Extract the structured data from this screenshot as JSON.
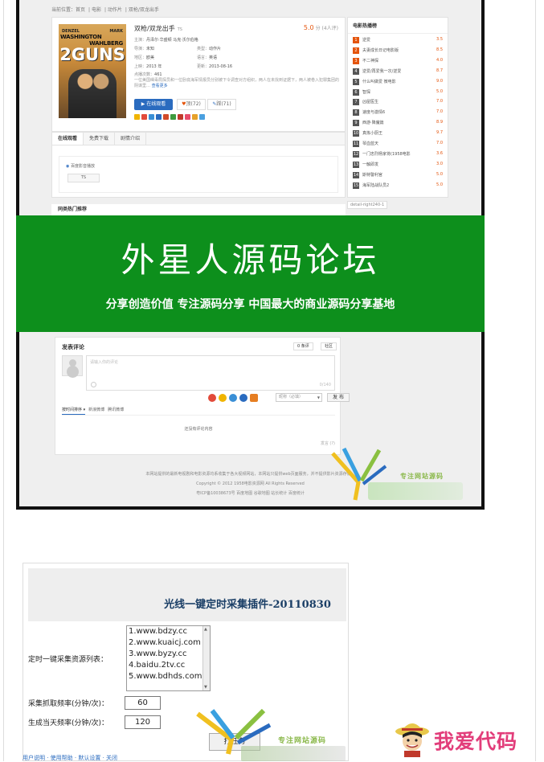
{
  "breadcrumb": [
    "当前位置：首页",
    "电影",
    "动作片",
    "双枪/双龙出手"
  ],
  "movie": {
    "title": "双枪/双龙出手",
    "tag": "TS",
    "score": "5.0",
    "score_unit": "分",
    "votes": "(4人评)",
    "info": [
      {
        "label": "主演：",
        "value": "丹泽尔·华盛顿  马克·沃尔伯格"
      },
      {
        "label": "导演：",
        "value": "未知"
      },
      {
        "label": "类型：",
        "value": "动作片"
      },
      {
        "label": "地区：",
        "value": "欧美"
      },
      {
        "label": "语言：",
        "value": "英语"
      },
      {
        "label": "上映：",
        "value": "2013 年"
      },
      {
        "label": "更新：",
        "value": "2013-08-16"
      },
      {
        "label": "点播次数：",
        "value": "461"
      }
    ],
    "description": "一位美国缉毒局探员和一位卧底海军情报员分别被下令调查对方组织，两人在未找到证据下，两人被卷入犯罪集团的阴谋里…",
    "more": "查看更多",
    "watch_btn": "在线观看",
    "up_btn": "顶(72)",
    "down_btn": "踩(71)",
    "poster": {
      "actor1": "DENZEL",
      "actor2": "MARK",
      "line1": "WASHINGTON",
      "line2": "WAHLBERG",
      "big": "2GUNS"
    }
  },
  "tabs": [
    "在线观看",
    "免费下载",
    "剧情介绍"
  ],
  "player": {
    "label": "百度影音播放",
    "ts": "TS"
  },
  "sidebar": {
    "title": "电影热播榜",
    "items": [
      {
        "no": "1",
        "name": "逆爱",
        "score": "3.5"
      },
      {
        "no": "2",
        "name": "夫妻成长日记电影版",
        "score": "8.5"
      },
      {
        "no": "3",
        "name": "不二神探",
        "score": "4.0"
      },
      {
        "no": "4",
        "name": "逆爱/再爱我一次/逆爱",
        "score": "8.7"
      },
      {
        "no": "5",
        "name": "什么叫做爱 微电影",
        "score": "9.0"
      },
      {
        "no": "6",
        "name": "智探",
        "score": "5.0"
      },
      {
        "no": "7",
        "name": "凶屋医生",
        "score": "7.0"
      },
      {
        "no": "8",
        "name": "速度与激情6",
        "score": "7.0"
      },
      {
        "no": "9",
        "name": "西游·降魔篇",
        "score": "8.9"
      },
      {
        "no": "10",
        "name": "真炼小厨王",
        "score": "9.7"
      },
      {
        "no": "11",
        "name": "琴血蓝天",
        "score": "7.0"
      },
      {
        "no": "12",
        "name": "一门忠烈杨家将(1958电影",
        "score": "3.6"
      },
      {
        "no": "13",
        "name": "一触即发",
        "score": "3.0"
      },
      {
        "no": "14",
        "name": "斯特警利官",
        "score": "5.0"
      },
      {
        "no": "15",
        "name": "海军陆战队员2",
        "score": "5.0"
      }
    ],
    "detail_label": "detail-right240-1"
  },
  "hot_recommend": "同类热门推荐",
  "banner": {
    "title": "外星人源码论坛",
    "subtitle": "分享创造价值 专注源码分享 中国最大的商业源码分享基地"
  },
  "comments": {
    "title": "发表评论",
    "count_btn": "0 条评",
    "social_btn": "社区",
    "placeholder": "请输入你的评论",
    "counter": "0/140",
    "nick": "昵称（必填）",
    "send": "发 布",
    "sort": [
      "按时间排序 ▾",
      "新浪微博",
      "腾讯微博"
    ],
    "empty": "还没有评论内容",
    "foot": "发言 (?)"
  },
  "footer": [
    "本网站提供的最新电视剧和电影资源均系收集于各大视频网站，本网站只提供web页面服务，并不提供影片资源存储，",
    "Copyright © 2012 1958电影资源网 All Rights Reserved",
    "粤ICP备10038673号 百度地图 谷歌地图 站长统计 百度统计"
  ],
  "watermark": "专注网站源码",
  "plugin": {
    "title": "光线一键定时采集插件-20110830",
    "list_label": "定时一键采集资源列表：",
    "list": [
      "1.www.bdzy.cc",
      "2.www.kuaicj.com",
      "3.www.byzy.cc",
      "4.baidu.2tv.cc",
      "5.www.bdhds.com"
    ],
    "freq_label": "采集抓取频率(分钟/次)：",
    "freq_value": "60",
    "gen_label": "生成当天频率(分钟/次)：",
    "gen_value": "120",
    "btn": "打任务",
    "link": "用户说明 · 使用帮助 · 默认设置 · 关闭"
  },
  "brand": "我爱代码",
  "colors": {
    "banner": "#0d8f1c",
    "accent": "#2a6bbf",
    "score": "#e4540c",
    "brand": "#e23d7a"
  }
}
